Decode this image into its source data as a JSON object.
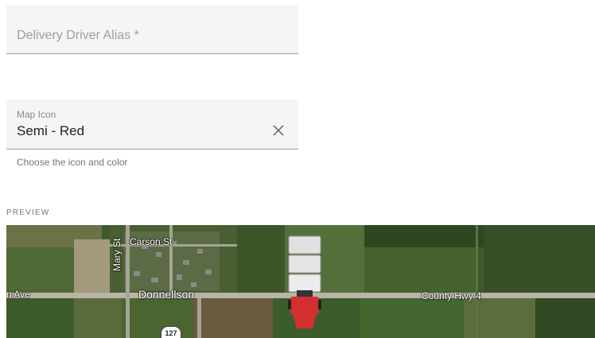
{
  "form": {
    "alias": {
      "placeholder": "Delivery Driver Alias *"
    },
    "map_icon": {
      "label": "Map Icon",
      "value": "Semi - Red",
      "helper": "Choose the icon and color"
    }
  },
  "preview": {
    "label": "PREVIEW",
    "map": {
      "labels": {
        "carson_st": "Carson St",
        "mary_st": "Mary St",
        "ave": "n Ave",
        "town": "Donnellson",
        "county_hwy": "County Hwy 4",
        "highway_number": "127"
      },
      "marker": {
        "icon": "semi-truck-icon",
        "color": "#d32f2f"
      }
    }
  }
}
